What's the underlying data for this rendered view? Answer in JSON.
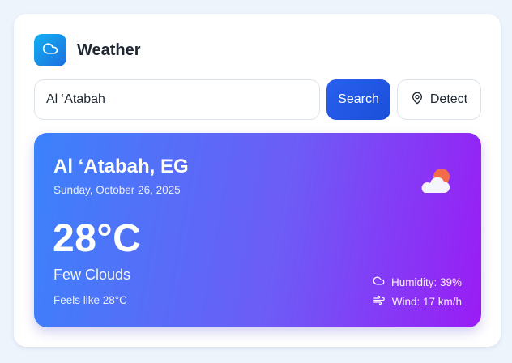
{
  "app": {
    "title": "Weather",
    "logo_icon": "cloud-icon",
    "accent": "#1d6fe0"
  },
  "search": {
    "value": "Al ‘Atabah",
    "search_label": "Search",
    "detect_label": "Detect",
    "detect_icon": "map-pin-icon"
  },
  "weather": {
    "location": "Al ‘Atabah, EG",
    "date": "Sunday, October 26, 2025",
    "temperature": "28°C",
    "condition": "Few Clouds",
    "condition_icon": "partly-cloudy-icon",
    "feels_like": "Feels like 28°C",
    "humidity": "Humidity: 39%",
    "humidity_icon": "cloud-icon",
    "wind": "Wind: 17 km/h",
    "wind_icon": "wind-icon",
    "gradient_start": "#3b82fb",
    "gradient_end": "#9a1cf5"
  }
}
